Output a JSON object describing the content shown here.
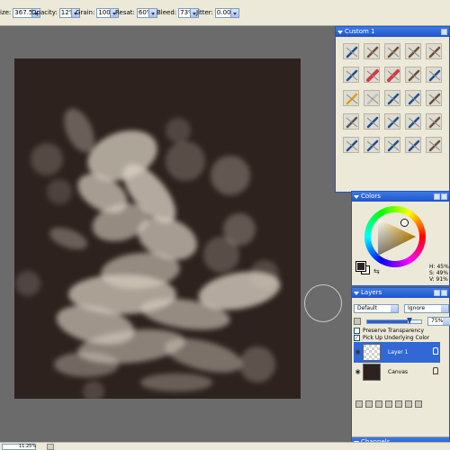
{
  "propbar": {
    "items": [
      {
        "label": "ize:",
        "value": "367.5"
      },
      {
        "label": "Opacity:",
        "value": "12%"
      },
      {
        "label": "Grain:",
        "value": "100"
      },
      {
        "label": "Resat:",
        "value": "60%"
      },
      {
        "label": "Bleed:",
        "value": "73%"
      },
      {
        "label": "Jitter:",
        "value": "0.00"
      }
    ]
  },
  "status": {
    "zoom": "11.25%"
  },
  "custom_palette": {
    "title": "Custom 1",
    "brush_icons": [
      "pen-icon",
      "brush-icon",
      "brush-icon",
      "brush-icon",
      "brush-icon",
      "pen-icon",
      "marker-icon",
      "marker-icon",
      "brush-icon",
      "pen-icon",
      "star-brush-icon",
      "pencil-icon",
      "pen-icon",
      "pen-icon",
      "brush-icon",
      "paint-roller-icon",
      "pen-icon",
      "pen-icon",
      "pen-icon",
      "brush-icon",
      "pen-icon",
      "pen-icon",
      "pen-icon",
      "pen-icon",
      "brush-icon"
    ]
  },
  "colors_palette": {
    "title": "Colors",
    "h": "H: 45%",
    "s": "S: 49%",
    "v": "V: 91%"
  },
  "layers_palette": {
    "title": "Layers",
    "composite_method": "Default",
    "composite_depth": "Ignore",
    "opacity": "75%",
    "preserve_transparency": "Preserve Transparency",
    "pick_up_underlying": "Pick Up Underlying Color",
    "layers": [
      {
        "name": "Layer 1",
        "selected": true
      },
      {
        "name": "Canvas",
        "selected": false
      }
    ]
  },
  "channels": {
    "title": "Channels"
  },
  "colors": {
    "painting_bg": "#2e221f",
    "paint": "#d9d0c2",
    "palette_title": "#2558cc",
    "selection": "#3168d5"
  }
}
